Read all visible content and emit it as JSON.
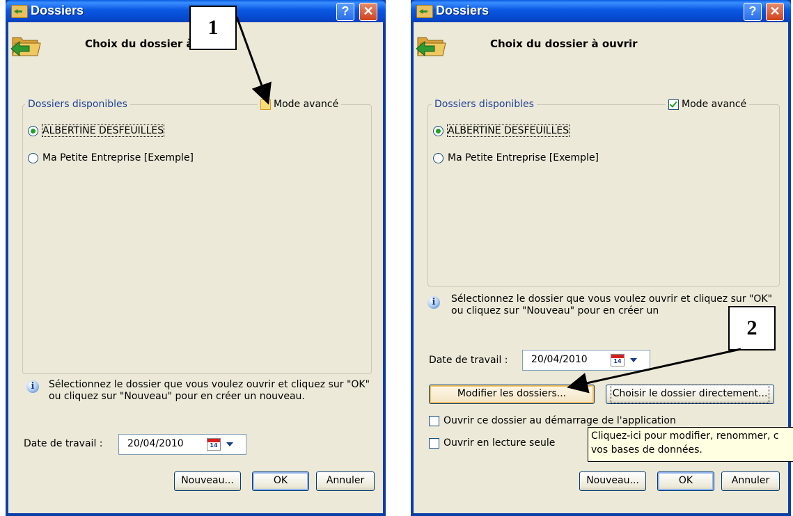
{
  "dialogs": [
    {
      "title": "Dossiers",
      "help_label": "?",
      "close_label": "✕",
      "header": "Choix du dossier à ouvrir",
      "group_label": "Dossiers disponibles",
      "advanced_mode_label": "Mode avancé",
      "advanced_mode_checked": false,
      "folders": [
        {
          "label": "ALBERTINE DESFEUILLES",
          "selected": true
        },
        {
          "label": "Ma Petite Entreprise [Exemple]",
          "selected": false
        }
      ],
      "info_text": "Sélectionnez le dossier que vous voulez ouvrir et cliquez sur \"OK\" ou cliquez sur \"Nouveau\" pour en créer un nouveau.",
      "date_label": "Date de travail :",
      "date_value": "20/04/2010",
      "calendar_day": "14",
      "buttons": {
        "new": "Nouveau...",
        "ok": "OK",
        "cancel": "Annuler"
      }
    },
    {
      "title": "Dossiers",
      "help_label": "?",
      "close_label": "✕",
      "header": "Choix du dossier à ouvrir",
      "group_label": "Dossiers disponibles",
      "advanced_mode_label": "Mode avancé",
      "advanced_mode_checked": true,
      "folders": [
        {
          "label": "ALBERTINE DESFEUILLES",
          "selected": true
        },
        {
          "label": "Ma Petite Entreprise [Exemple]",
          "selected": false
        }
      ],
      "info_text": "Sélectionnez le dossier que vous voulez ouvrir et cliquez sur \"OK\" ou cliquez sur \"Nouveau\" pour en créer un",
      "date_label": "Date de travail :",
      "date_value": "20/04/2010",
      "calendar_day": "14",
      "modify_button": "Modifier les dossiers...",
      "choose_directly_button": "Choisir le dossier directement...",
      "open_at_startup_label": "Ouvrir ce dossier au démarrage de l'application",
      "open_at_startup_checked": false,
      "read_only_label": "Ouvrir en lecture seule",
      "read_only_checked": false,
      "tooltip": "Cliquez-ici pour modifier, renommer, c vos bases de données.",
      "buttons": {
        "new": "Nouveau...",
        "ok": "OK",
        "cancel": "Annuler"
      }
    }
  ],
  "callouts": [
    "1",
    "2"
  ]
}
